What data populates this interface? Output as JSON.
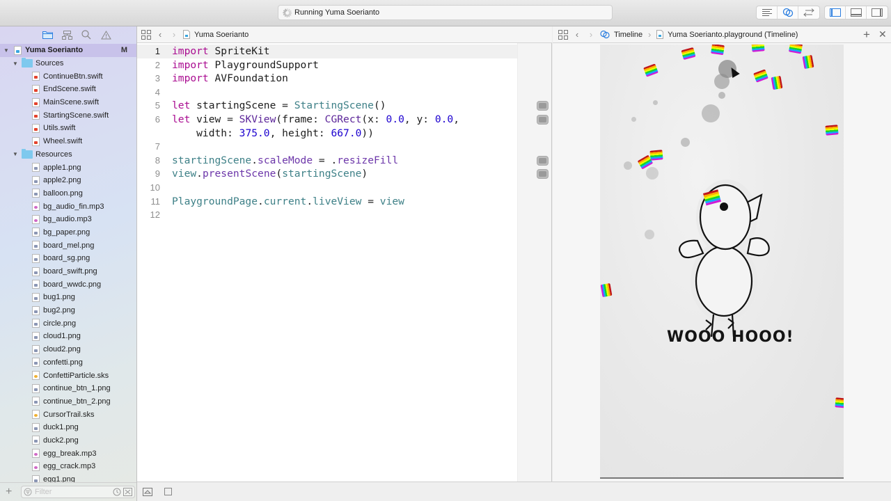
{
  "window": {
    "activity_text": "Running Yuma Soerianto"
  },
  "toolbar": {
    "editor_buttons": [
      "standard-editor",
      "assistant-editor",
      "version-editor"
    ],
    "view_buttons": [
      "navigator",
      "debug-area",
      "utilities"
    ]
  },
  "navigator": {
    "tabs": [
      "project-navigator",
      "symbol-navigator",
      "find-navigator",
      "issue-navigator"
    ],
    "project": {
      "name": "Yuma Soerianto",
      "badge": "M"
    },
    "groups": [
      {
        "name": "Sources",
        "files": [
          {
            "name": "ContinueBtn.swift",
            "type": "swift"
          },
          {
            "name": "EndScene.swift",
            "type": "swift"
          },
          {
            "name": "MainScene.swift",
            "type": "swift"
          },
          {
            "name": "StartingScene.swift",
            "type": "swift"
          },
          {
            "name": "Utils.swift",
            "type": "swift"
          },
          {
            "name": "Wheel.swift",
            "type": "swift"
          }
        ]
      },
      {
        "name": "Resources",
        "files": [
          {
            "name": "apple1.png",
            "type": "png"
          },
          {
            "name": "apple2.png",
            "type": "png"
          },
          {
            "name": "balloon.png",
            "type": "png"
          },
          {
            "name": "bg_audio_fin.mp3",
            "type": "mp3"
          },
          {
            "name": "bg_audio.mp3",
            "type": "mp3"
          },
          {
            "name": "bg_paper.png",
            "type": "png"
          },
          {
            "name": "board_mel.png",
            "type": "png"
          },
          {
            "name": "board_sg.png",
            "type": "png"
          },
          {
            "name": "board_swift.png",
            "type": "png"
          },
          {
            "name": "board_wwdc.png",
            "type": "png"
          },
          {
            "name": "bug1.png",
            "type": "png"
          },
          {
            "name": "bug2.png",
            "type": "png"
          },
          {
            "name": "circle.png",
            "type": "png"
          },
          {
            "name": "cloud1.png",
            "type": "png"
          },
          {
            "name": "cloud2.png",
            "type": "png"
          },
          {
            "name": "confetti.png",
            "type": "png"
          },
          {
            "name": "ConfettiParticle.sks",
            "type": "sks"
          },
          {
            "name": "continue_btn_1.png",
            "type": "png"
          },
          {
            "name": "continue_btn_2.png",
            "type": "png"
          },
          {
            "name": "CursorTrail.sks",
            "type": "sks"
          },
          {
            "name": "duck1.png",
            "type": "png"
          },
          {
            "name": "duck2.png",
            "type": "png"
          },
          {
            "name": "egg_break.mp3",
            "type": "mp3"
          },
          {
            "name": "egg_crack.mp3",
            "type": "mp3"
          },
          {
            "name": "egg1.png",
            "type": "png"
          }
        ]
      }
    ],
    "filter_placeholder": "Filter"
  },
  "editor": {
    "jump_bar": "Yuma Soerianto",
    "current_line": 1,
    "lines": [
      {
        "n": "1",
        "tokens": [
          [
            "kw",
            "import"
          ],
          [
            "p",
            " SpriteKit"
          ]
        ]
      },
      {
        "n": "2",
        "tokens": [
          [
            "kw",
            "import"
          ],
          [
            "p",
            " PlaygroundSupport"
          ]
        ]
      },
      {
        "n": "3",
        "tokens": [
          [
            "kw",
            "import"
          ],
          [
            "p",
            " AVFoundation"
          ]
        ]
      },
      {
        "n": "4",
        "tokens": []
      },
      {
        "n": "5",
        "tokens": [
          [
            "kw",
            "let"
          ],
          [
            "p",
            " startingScene = "
          ],
          [
            "ty",
            "StartingScene"
          ],
          [
            "p",
            "()"
          ]
        ]
      },
      {
        "n": "6",
        "tokens": [
          [
            "kw",
            "let"
          ],
          [
            "p",
            " view = "
          ],
          [
            "cls",
            "SKView"
          ],
          [
            "p",
            "(frame: "
          ],
          [
            "cls",
            "CGRect"
          ],
          [
            "p",
            "(x: "
          ],
          [
            "num",
            "0.0"
          ],
          [
            "p",
            ", y: "
          ],
          [
            "num",
            "0.0"
          ],
          [
            "p",
            ","
          ]
        ]
      },
      {
        "n": "",
        "tokens": [
          [
            "p",
            "    width: "
          ],
          [
            "num",
            "375.0"
          ],
          [
            "p",
            ", height: "
          ],
          [
            "num",
            "667.0"
          ],
          [
            "p",
            "))"
          ]
        ]
      },
      {
        "n": "7",
        "tokens": []
      },
      {
        "n": "8",
        "tokens": [
          [
            "ty",
            "startingScene"
          ],
          [
            "p",
            "."
          ],
          [
            "fn",
            "scaleMode"
          ],
          [
            "p",
            " = ."
          ],
          [
            "fn",
            "resizeFill"
          ]
        ]
      },
      {
        "n": "9",
        "tokens": [
          [
            "ty",
            "view"
          ],
          [
            "p",
            "."
          ],
          [
            "fn",
            "presentScene"
          ],
          [
            "p",
            "("
          ],
          [
            "ty",
            "startingScene"
          ],
          [
            "p",
            ")"
          ]
        ]
      },
      {
        "n": "10",
        "tokens": []
      },
      {
        "n": "11",
        "tokens": [
          [
            "ty",
            "PlaygroundPage"
          ],
          [
            "p",
            "."
          ],
          [
            "prop",
            "current"
          ],
          [
            "p",
            "."
          ],
          [
            "prop",
            "liveView"
          ],
          [
            "p",
            " = "
          ],
          [
            "ty",
            "view"
          ]
        ]
      },
      {
        "n": "12",
        "tokens": []
      }
    ],
    "quicklook_rows": [
      5,
      6,
      8,
      9
    ]
  },
  "assistant": {
    "breadcrumb": [
      "Timeline",
      "Yuma Soerianto.playground (Timeline)"
    ],
    "live_view": {
      "caption": "WOOO HOOO!"
    }
  },
  "colors": {
    "keyword": "#aa0d91",
    "type": "#3e8087",
    "number": "#1c00cf",
    "selection": "#c8c2ea"
  }
}
